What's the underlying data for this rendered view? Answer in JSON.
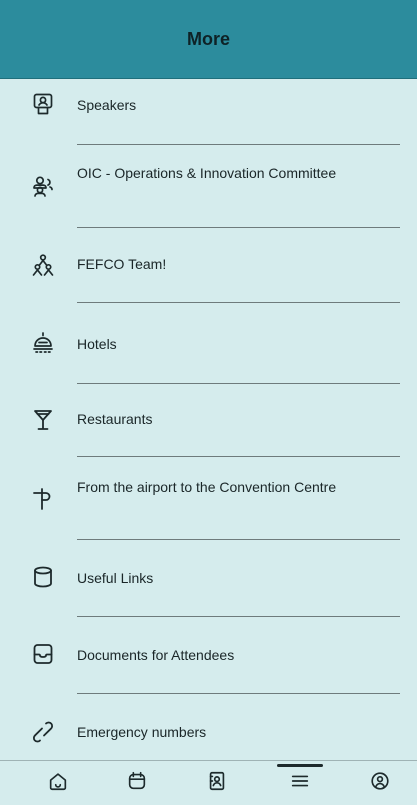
{
  "header": {
    "title": "More"
  },
  "menu": {
    "items": [
      {
        "label": "Speakers",
        "icon": "speaker-podium-icon"
      },
      {
        "label": "OIC - Operations & Innovation Committee",
        "icon": "group-icon"
      },
      {
        "label": "FEFCO Team!",
        "icon": "team-icon"
      },
      {
        "label": "Hotels",
        "icon": "hotel-bell-icon"
      },
      {
        "label": "Restaurants",
        "icon": "cocktail-glass-icon"
      },
      {
        "label": "From the airport to the Convention Centre",
        "icon": "signpost-icon"
      },
      {
        "label": "Useful Links",
        "icon": "cylinder-icon"
      },
      {
        "label": "Documents for Attendees",
        "icon": "tray-icon"
      },
      {
        "label": "Emergency numbers",
        "icon": "phone-icon"
      }
    ]
  },
  "tabbar": {
    "tabs": [
      {
        "icon": "home-icon",
        "selected": false
      },
      {
        "icon": "calendar-icon",
        "selected": false
      },
      {
        "icon": "contact-card-icon",
        "selected": false
      },
      {
        "icon": "menu-icon",
        "selected": true
      },
      {
        "icon": "profile-icon",
        "selected": false
      }
    ]
  },
  "colors": {
    "header": "#2c8c9d",
    "background": "#d5eced",
    "text": "#1d2a2c"
  }
}
